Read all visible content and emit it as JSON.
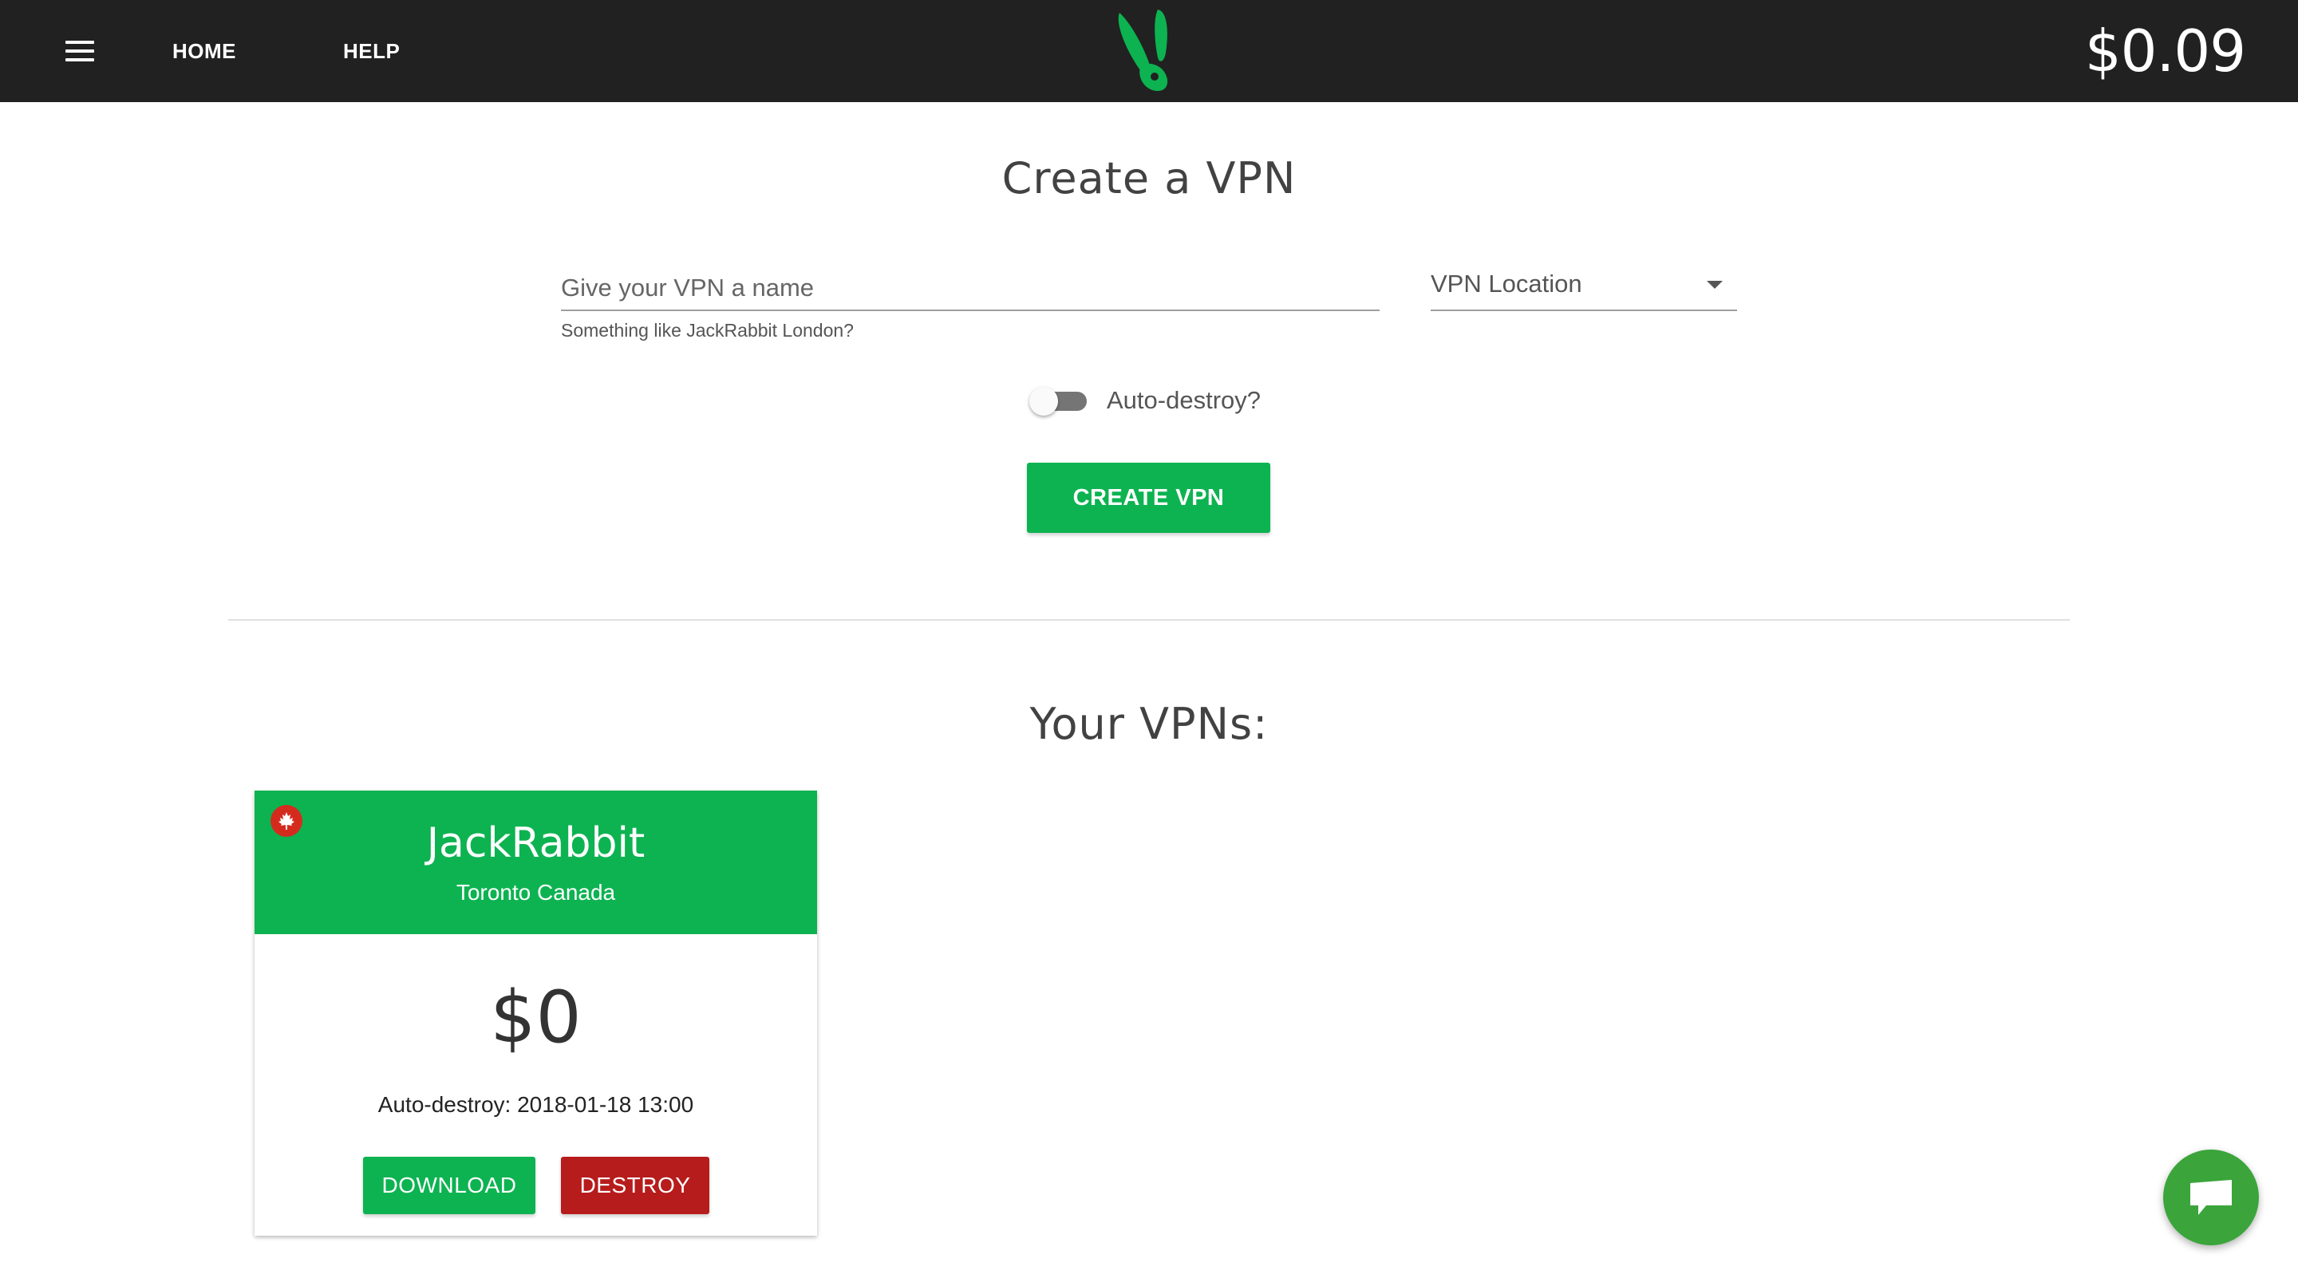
{
  "header": {
    "nav": {
      "home_label": "HOME",
      "help_label": "HELP"
    },
    "balance": "$0.09",
    "menu_icon": "hamburger-menu-icon",
    "logo_icon": "rabbit-ears-logo-icon"
  },
  "create": {
    "title": "Create a VPN",
    "name_placeholder": "Give your VPN a name",
    "name_value": "",
    "name_hint": "Something like JackRabbit London?",
    "location_label": "VPN Location",
    "auto_destroy_label": "Auto-destroy?",
    "auto_destroy_on": false,
    "button_label": "CREATE VPN"
  },
  "vpns": {
    "title": "Your VPNs:",
    "items": [
      {
        "name": "JackRabbit",
        "location": "Toronto Canada",
        "flag_icon": "canada-flag-icon",
        "cost": "$0",
        "auto_destroy": "Auto-destroy: 2018-01-18 13:00",
        "download_label": "DOWNLOAD",
        "destroy_label": "DESTROY"
      }
    ]
  },
  "chat": {
    "icon": "chat-bubble-icon"
  },
  "colors": {
    "topbar": "#212121",
    "accent_green": "#0db351",
    "destroy_red": "#b71c1c",
    "chat_green": "#3ba53b"
  }
}
